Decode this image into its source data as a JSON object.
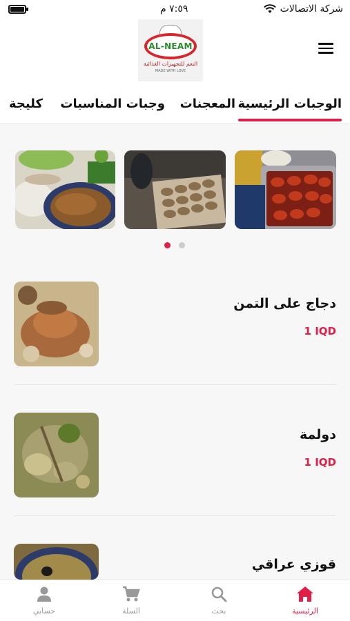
{
  "status_bar": {
    "carrier": "شركة الاتصالات",
    "time": "٧:٥٩ م",
    "battery_level": 0.9
  },
  "header": {
    "logo": {
      "brand": "AL-NEAM",
      "subtitle": "النعم للتجهيزات الغذائية",
      "tagline": "MADE WITH LOVE"
    },
    "menu_icon": "hamburger-icon"
  },
  "tabs": [
    {
      "label": "الوجبات الرئيسية",
      "active": true
    },
    {
      "label": "المعجنات",
      "active": false
    },
    {
      "label": "وجبات المناسبات",
      "active": false
    },
    {
      "label": "كليجة",
      "active": false
    }
  ],
  "carousel": {
    "page_count": 2,
    "active_page": 1
  },
  "products": [
    {
      "name": "دجاج على التمن",
      "price": "1 IQD"
    },
    {
      "name": "دولمة",
      "price": "1 IQD"
    },
    {
      "name": "قوزي عراقي",
      "price": ""
    }
  ],
  "bottom_nav": [
    {
      "label": "الرئيسية",
      "icon": "home-icon",
      "active": true
    },
    {
      "label": "بحث",
      "icon": "search-icon",
      "active": false
    },
    {
      "label": "السلة",
      "icon": "cart-icon",
      "active": false
    },
    {
      "label": "حسابي",
      "icon": "user-icon",
      "active": false
    }
  ],
  "colors": {
    "accent": "#e11d48",
    "inactive": "#999999"
  }
}
